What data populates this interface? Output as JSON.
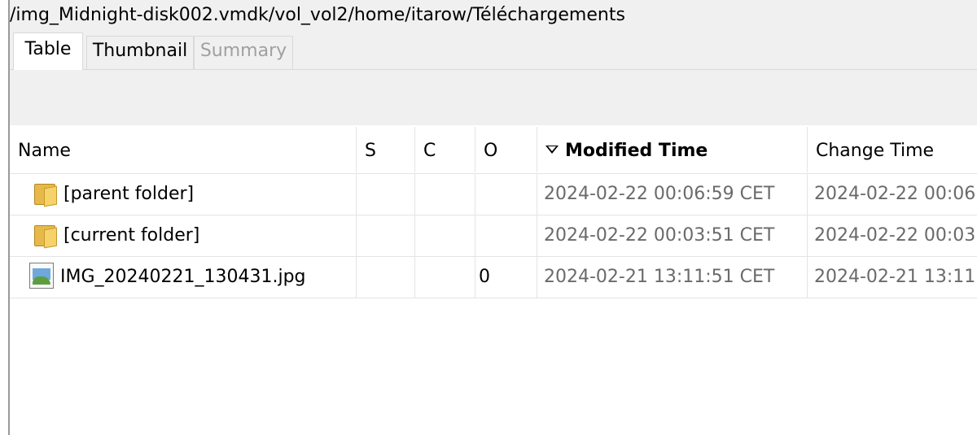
{
  "path": "/img_Midnight-disk002.vmdk/vol_vol2/home/itarow/Téléchargements",
  "tabs": [
    {
      "label": "Table"
    },
    {
      "label": "Thumbnail"
    },
    {
      "label": "Summary"
    }
  ],
  "table": {
    "columns": {
      "name": "Name",
      "s": "S",
      "c": "C",
      "o": "O",
      "modified": "Modified Time",
      "change": "Change Time"
    },
    "rows": [
      {
        "icon": "folder-icon",
        "name": "[parent folder]",
        "s": "",
        "c": "",
        "o": "",
        "modified": "2024-02-22 00:06:59 CET",
        "change": "2024-02-22 00:06"
      },
      {
        "icon": "folder-icon",
        "name": "[current folder]",
        "s": "",
        "c": "",
        "o": "",
        "modified": "2024-02-22 00:03:51 CET",
        "change": "2024-02-22 00:03"
      },
      {
        "icon": "image-file-icon",
        "name": "IMG_20240221_130431.jpg",
        "s": "",
        "c": "",
        "o": "0",
        "modified": "2024-02-21 13:11:51 CET",
        "change": "2024-02-21 13:11"
      }
    ]
  }
}
